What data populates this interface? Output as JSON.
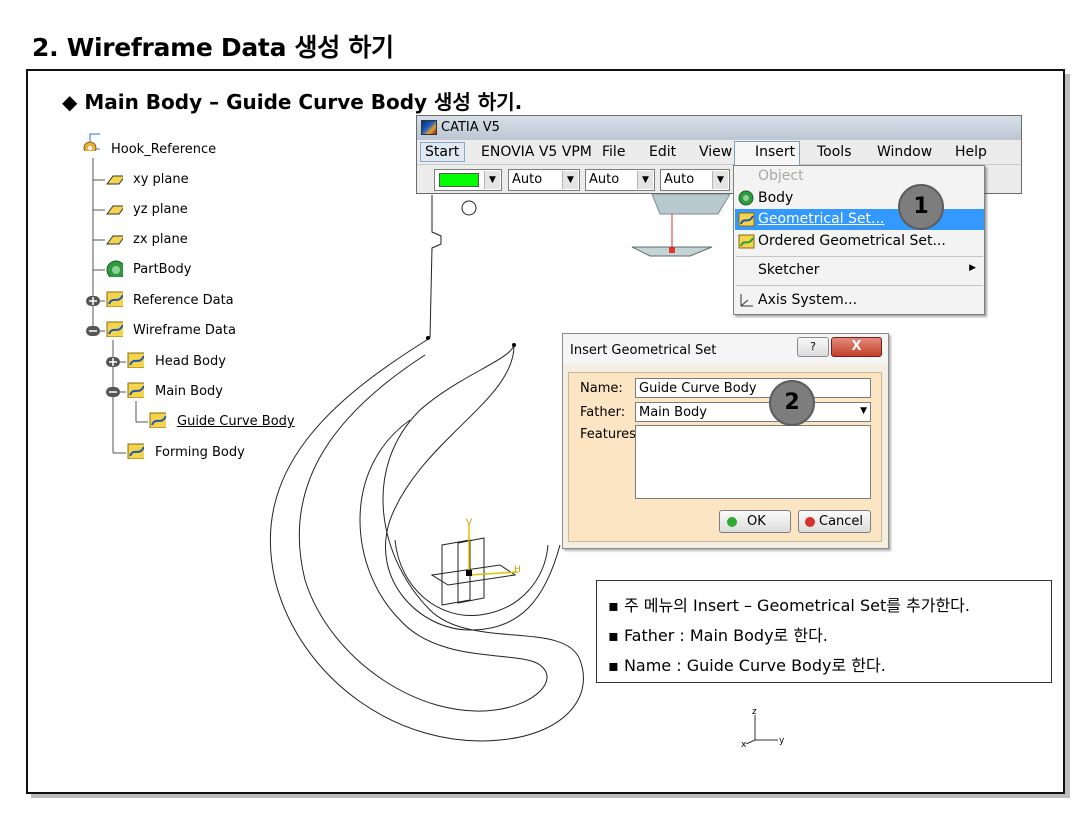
{
  "slide": {
    "title": "2. Wireframe Data 생성 하기",
    "subtitle": "◆ Main Body – Guide Curve Body 생성 하기."
  },
  "tree": [
    {
      "label": "Hook_Reference",
      "icon": "product-icon"
    },
    {
      "label": "xy plane",
      "icon": "plane-icon"
    },
    {
      "label": "yz plane",
      "icon": "plane-icon"
    },
    {
      "label": "zx plane",
      "icon": "plane-icon"
    },
    {
      "label": "PartBody",
      "icon": "partbody-icon"
    },
    {
      "label": "Reference Data",
      "icon": "geometrical-set-icon"
    },
    {
      "label": "Wireframe Data",
      "icon": "geometrical-set-icon"
    },
    {
      "label": "Head Body",
      "icon": "geometrical-set-icon"
    },
    {
      "label": "Main Body",
      "icon": "geometrical-set-icon"
    },
    {
      "label": "Guide Curve Body",
      "icon": "geometrical-set-icon"
    },
    {
      "label": "Forming Body",
      "icon": "geometrical-set-icon"
    }
  ],
  "catia": {
    "title": "CATIA V5",
    "menu": [
      "Start",
      "ENOVIA V5 VPM",
      "File",
      "Edit",
      "View",
      "Insert",
      "Tools",
      "Window",
      "Help"
    ],
    "toolbar": {
      "color": "#00ff00",
      "dropdowns": [
        "Auto",
        "Auto",
        "Auto"
      ]
    }
  },
  "insert_menu": {
    "items": [
      "Object",
      "Body",
      "Geometrical Set...",
      "Ordered Geometrical Set...",
      "Sketcher",
      "Axis System..."
    ],
    "selected": "Geometrical Set...",
    "disabled": "Object",
    "highlight_color": "#3399ff"
  },
  "badges": [
    "1",
    "2"
  ],
  "dialog": {
    "title": "Insert Geometrical Set",
    "help": "?",
    "close": "X",
    "name_label": "Name:",
    "name_value": "Guide Curve Body",
    "father_label": "Father:",
    "father_value": "Main Body",
    "features_label": "Features:",
    "ok": "OK",
    "cancel": "Cancel"
  },
  "notes": [
    "주 메뉴의 Insert – Geometrical Set를 추가한다.",
    "Father : Main Body로 한다.",
    "Name : Guide Curve Body로 한다."
  ],
  "axes": {
    "h": "H",
    "v": "V",
    "y": "y",
    "z": "z",
    "x": "x"
  }
}
